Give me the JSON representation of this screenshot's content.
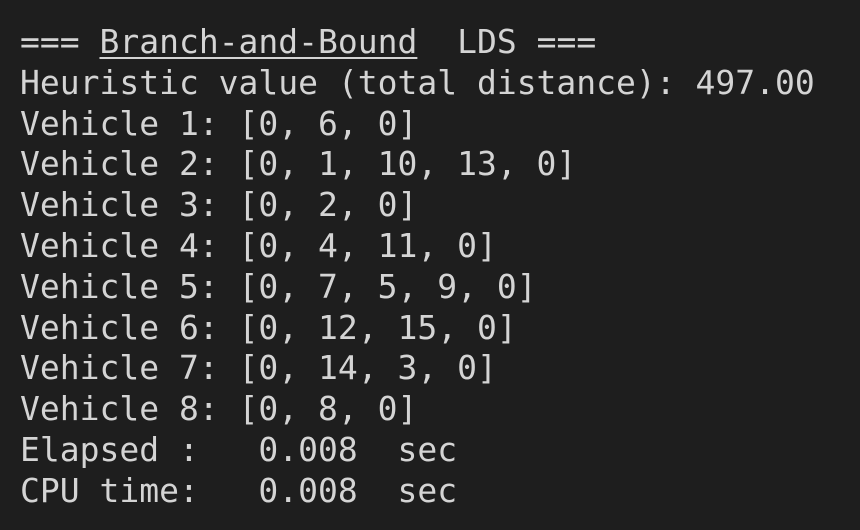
{
  "terminal": {
    "header": {
      "prefix": "=== ",
      "title": "Branch-and-Bound",
      "suffix": "  LDS ==="
    },
    "heuristic": "Heuristic value (total distance): 497.00",
    "vehicles": [
      "Vehicle 1: [0, 6, 0]",
      "Vehicle 2: [0, 1, 10, 13, 0]",
      "Vehicle 3: [0, 2, 0]",
      "Vehicle 4: [0, 4, 11, 0]",
      "Vehicle 5: [0, 7, 5, 9, 0]",
      "Vehicle 6: [0, 12, 15, 0]",
      "Vehicle 7: [0, 14, 3, 0]",
      "Vehicle 8: [0, 8, 0]"
    ],
    "elapsed": "Elapsed :   0.008  sec",
    "cpu_time": "CPU time:   0.008  sec"
  },
  "colors": {
    "background": "#1e1e1e",
    "text": "#d4d4d4"
  }
}
